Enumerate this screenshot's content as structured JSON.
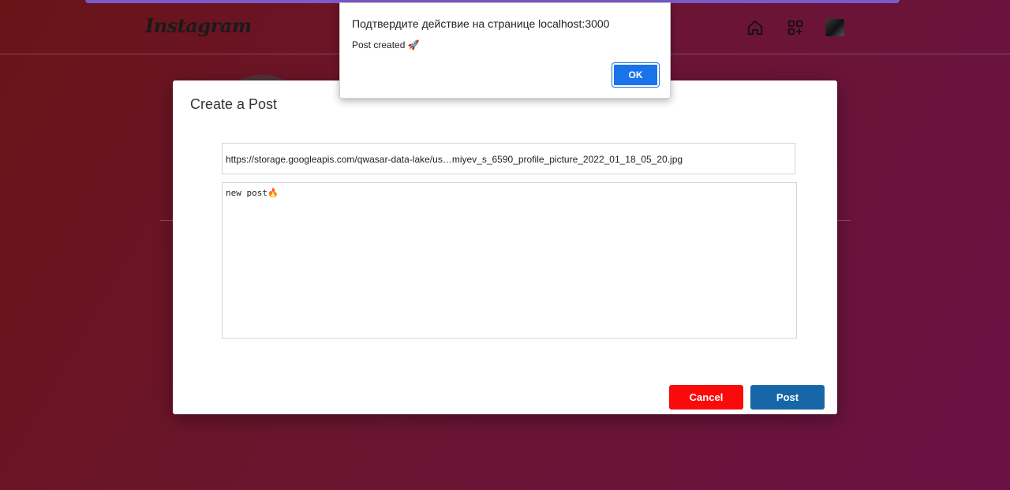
{
  "navbar": {
    "logo": "Instagram",
    "icons": [
      "home-icon",
      "add-post-icon",
      "profile-avatar"
    ]
  },
  "modal": {
    "title": "Create a Post",
    "url_value": "https://storage.googleapis.com/qwasar-data-lake/us…miyev_s_6590_profile_picture_2022_01_18_05_20.jpg",
    "caption_value": "new post🔥",
    "cancel_label": "Cancel",
    "post_label": "Post"
  },
  "alert": {
    "title": "Подтвердите действие на странице localhost:3000",
    "message": "Post created 🚀",
    "ok_label": "OK"
  },
  "colors": {
    "cancel": "#fa0a0a",
    "post": "#1767a8",
    "ok": "#1a73e8",
    "accent_stripe": "#7b5ac9"
  }
}
